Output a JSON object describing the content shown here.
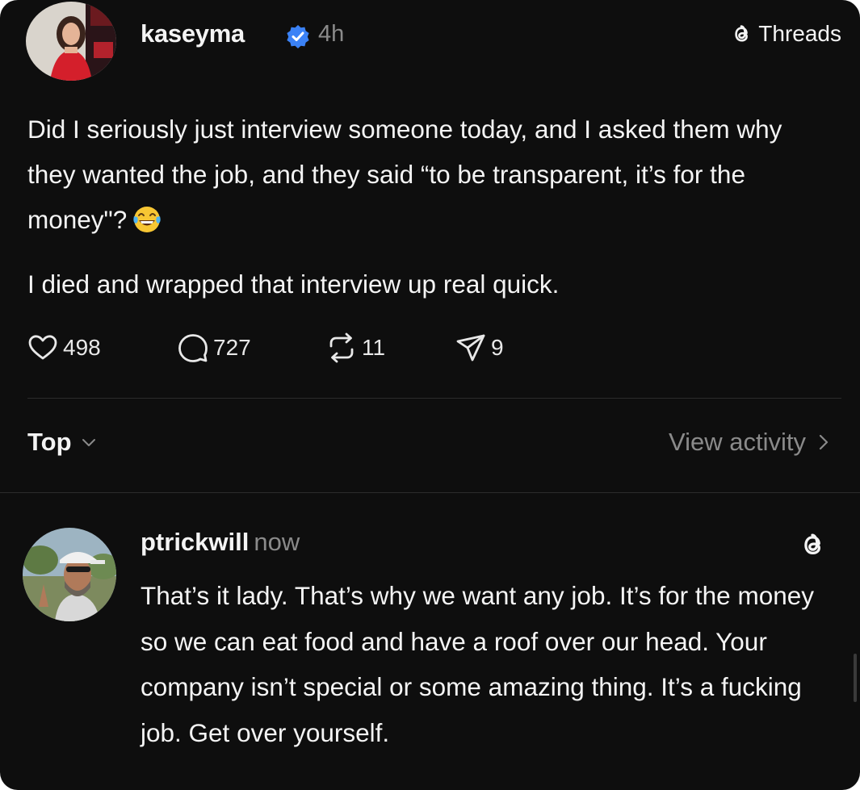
{
  "post": {
    "username": "kaseyma",
    "time": "4h",
    "platform_label": "Threads",
    "paragraphs": [
      "Did I seriously just interview someone today, and I asked them why they wanted the job, and they said “to be transparent, it’s for the money\"?",
      "I died and wrapped that interview up real quick."
    ],
    "emoji": "face-with-tears-of-joy",
    "stats": {
      "likes": "498",
      "replies": "727",
      "reposts": "11",
      "shares": "9"
    }
  },
  "sort": {
    "label": "Top",
    "view_activity": "View activity"
  },
  "reply": {
    "username": "ptrickwill",
    "time": "now",
    "text": "That’s it lady. That’s why we want any job. It’s for the money so we can eat food and have a roof over our head. Your company isn’t special or some amazing thing. It’s a fucking job. Get over yourself."
  },
  "colors": {
    "background": "#0e0e0e",
    "text": "#f4f4f4",
    "muted": "#8a8a8a",
    "verified": "#3b82f6",
    "divider": "#2c2c2c"
  },
  "icons": [
    "heart-icon",
    "comment-icon",
    "repost-icon",
    "share-icon",
    "threads-logo-icon",
    "verified-badge-icon",
    "chevron-down-icon",
    "chevron-right-icon"
  ]
}
